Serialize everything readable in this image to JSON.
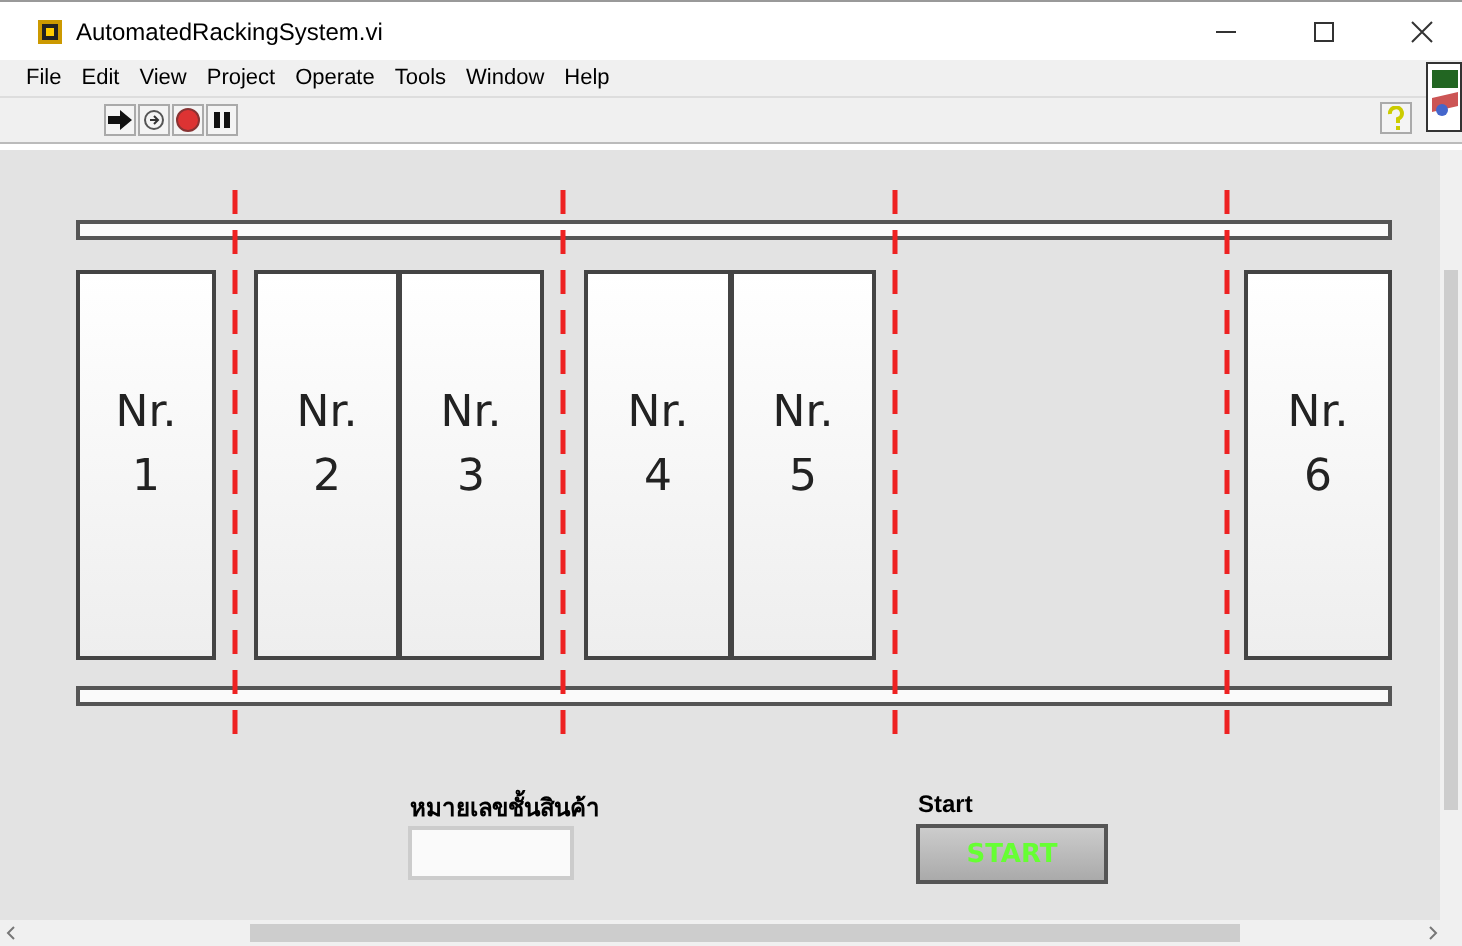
{
  "window": {
    "title": "AutomatedRackingSystem.vi"
  },
  "menu": [
    "File",
    "Edit",
    "View",
    "Project",
    "Operate",
    "Tools",
    "Window",
    "Help"
  ],
  "panel": {
    "slots": [
      {
        "label": "Nr. 1"
      },
      {
        "label": "Nr. 2"
      },
      {
        "label": "Nr. 3"
      },
      {
        "label": "Nr. 4"
      },
      {
        "label": "Nr. 5"
      },
      {
        "label": "Nr. 6"
      }
    ],
    "shelf_field": {
      "label": "หมายเลขชั้นสินค้า"
    },
    "start": {
      "label": "Start",
      "button": "START"
    }
  }
}
